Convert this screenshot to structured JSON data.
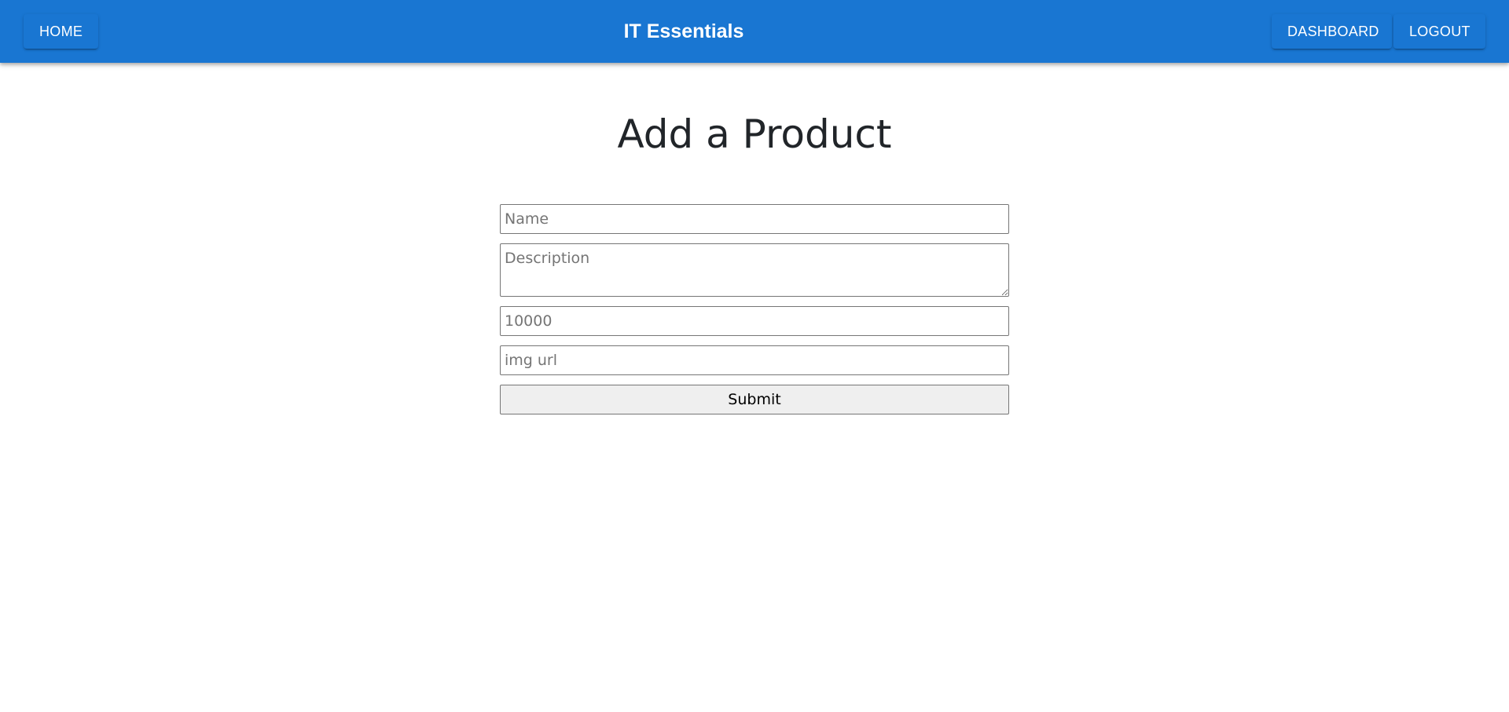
{
  "header": {
    "title": "IT Essentials",
    "home_label": "HOME",
    "dashboard_label": "DASHBOARD",
    "logout_label": "LOGOUT",
    "bar_color": "#1976d2"
  },
  "page": {
    "heading": "Add a Product"
  },
  "form": {
    "name": {
      "placeholder": "Name",
      "value": ""
    },
    "description": {
      "placeholder": "Description",
      "value": ""
    },
    "price": {
      "placeholder": "10000",
      "value": ""
    },
    "image": {
      "placeholder": "img url",
      "value": ""
    },
    "submit_label": "Submit"
  }
}
